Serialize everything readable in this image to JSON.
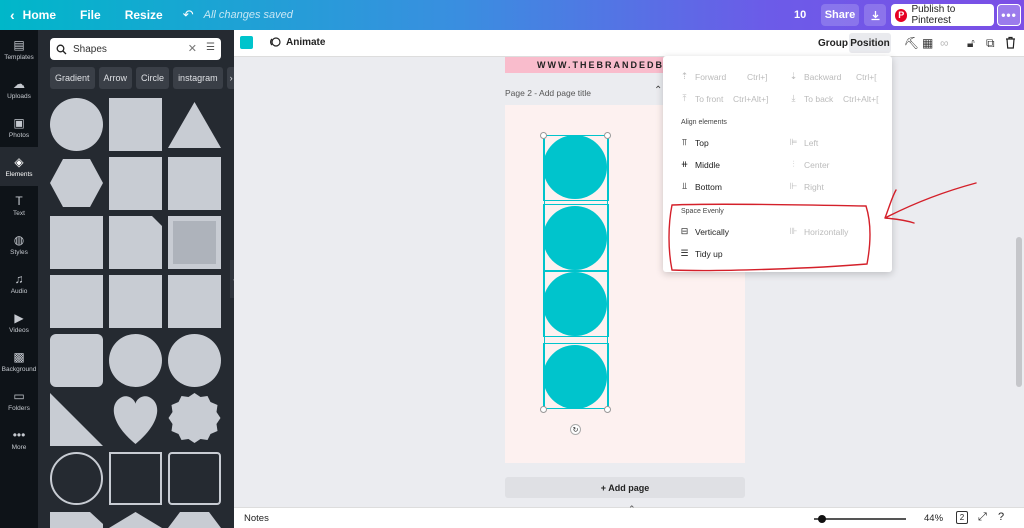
{
  "topbar": {
    "back_label": "Home",
    "file_label": "File",
    "resize_label": "Resize",
    "saved_text": "All changes saved",
    "collaborator_count": "10",
    "share_label": "Share",
    "publish_label": "Publish to Pinterest",
    "more_label": "•••",
    "gradient_colors": [
      "#00b7c9",
      "#3a8ee0",
      "#6c5be8",
      "#7b4fe6"
    ]
  },
  "rail": {
    "items": [
      {
        "label": "Templates",
        "icon": "layout-icon"
      },
      {
        "label": "Uploads",
        "icon": "cloud-upload-icon"
      },
      {
        "label": "Photos",
        "icon": "image-icon"
      },
      {
        "label": "Elements",
        "icon": "shapes-icon",
        "active": true
      },
      {
        "label": "Text",
        "icon": "text-icon"
      },
      {
        "label": "Styles",
        "icon": "palette-icon"
      },
      {
        "label": "Audio",
        "icon": "music-note-icon"
      },
      {
        "label": "Videos",
        "icon": "video-icon"
      },
      {
        "label": "Background",
        "icon": "background-pattern-icon"
      },
      {
        "label": "Folders",
        "icon": "folder-icon"
      },
      {
        "label": "More",
        "icon": "ellipsis-icon"
      }
    ]
  },
  "panel": {
    "search_value": "Shapes",
    "chips": [
      "Gradient",
      "Arrow",
      "Circle",
      "instagram"
    ],
    "shape_color": "#c8ccd3"
  },
  "toolbar": {
    "swatch_color": "#00c4cc",
    "animate_label": "Animate",
    "group_label": "Group",
    "position_label": "Position"
  },
  "canvas": {
    "prev_page_text": "WWW.THEBRANDEDBU",
    "page_title": "Page 2 - Add page title",
    "add_page_label": "+ Add page",
    "circle_color": "#00c4cc",
    "page_background": "#fdf1f0"
  },
  "position_menu": {
    "forward": {
      "label": "Forward",
      "shortcut": "Ctrl+]"
    },
    "backward": {
      "label": "Backward",
      "shortcut": "Ctrl+["
    },
    "to_front": {
      "label": "To front",
      "shortcut": "Ctrl+Alt+]"
    },
    "to_back": {
      "label": "To back",
      "shortcut": "Ctrl+Alt+["
    },
    "align_heading": "Align elements",
    "top": "Top",
    "left": "Left",
    "middle": "Middle",
    "center": "Center",
    "bottom": "Bottom",
    "right": "Right",
    "space_heading": "Space Evenly",
    "vertically": "Vertically",
    "horizontally": "Horizontally",
    "tidy_up": "Tidy up",
    "annotation_color": "#d4202a"
  },
  "bottombar": {
    "notes_label": "Notes",
    "zoom_value": "44%",
    "page_count": "2"
  }
}
